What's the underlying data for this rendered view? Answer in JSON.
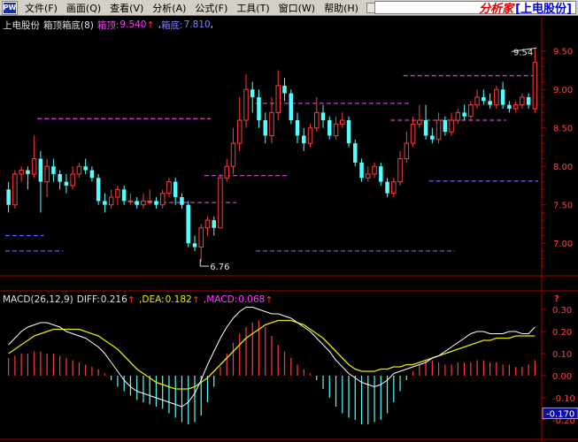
{
  "menu": {
    "logo": "PW",
    "items": [
      "文件(F)",
      "画面(Q)",
      "查看(V)",
      "分析(A)",
      "公式(F)",
      "工具(T)",
      "窗口(W)",
      "帮助(H)"
    ],
    "brand_name": "分析家",
    "brand_sub": "[上电股份]"
  },
  "price_panel": {
    "stock_name": "上电股份",
    "indicator": "箱顶箱底(8)",
    "box_top_label": "箱顶:",
    "box_top_value": "9.540",
    "box_bottom_label": "箱底:",
    "box_bottom_value": "7.810",
    "trailing": ",",
    "y_ticks": [
      "9.50",
      "9.00",
      "8.50",
      "8.00",
      "7.50",
      "7.00"
    ],
    "high_annotation": "9.54",
    "low_annotation": "6.76"
  },
  "macd_panel": {
    "title": "MACD(26,12,9)",
    "diff_label": "DIFF:",
    "diff_value": "0.216",
    "dea_label": "DEA:",
    "dea_value": "0.182",
    "macd_label": "MACD:",
    "macd_value": "0.068",
    "y_ticks": [
      "0.30",
      "0.20",
      "0.10",
      "0.00",
      "-0.10",
      "-0.20"
    ],
    "highlight_value": "-0.170",
    "question_mark": "?"
  },
  "colors": {
    "up": "#ff3c3c",
    "down": "#54ffff",
    "box_line": "#d040d0",
    "box_line_low": "#6060ff",
    "axis": "#b00000",
    "diff_line": "#ffffff",
    "dea_line": "#e8e800",
    "macd_label": "#ff40ff"
  },
  "chart_data": {
    "type": "candlestick",
    "price_ylim": [
      6.6,
      9.75
    ],
    "candles": [
      [
        7.7,
        7.5,
        7.8,
        7.4
      ],
      [
        7.5,
        7.9,
        7.95,
        7.45
      ],
      [
        7.9,
        7.95,
        8.0,
        7.8
      ],
      [
        7.95,
        7.9,
        8.0,
        7.7
      ],
      [
        7.9,
        8.1,
        8.4,
        7.85
      ],
      [
        8.1,
        7.8,
        8.2,
        7.4
      ],
      [
        7.8,
        8.0,
        8.1,
        7.6
      ],
      [
        8.0,
        7.9,
        8.1,
        7.8
      ],
      [
        7.9,
        7.8,
        7.95,
        7.7
      ],
      [
        7.8,
        7.75,
        7.9,
        7.65
      ],
      [
        7.75,
        7.9,
        8.0,
        7.7
      ],
      [
        7.9,
        8.0,
        8.05,
        7.85
      ],
      [
        8.0,
        7.95,
        8.1,
        7.9
      ],
      [
        7.95,
        7.85,
        8.0,
        7.8
      ],
      [
        7.85,
        7.55,
        7.9,
        7.5
      ],
      [
        7.55,
        7.5,
        7.65,
        7.4
      ],
      [
        7.5,
        7.6,
        7.7,
        7.45
      ],
      [
        7.6,
        7.7,
        7.75,
        7.5
      ],
      [
        7.7,
        7.55,
        7.75,
        7.5
      ],
      [
        7.55,
        7.55,
        7.65,
        7.5
      ],
      [
        7.55,
        7.5,
        7.6,
        7.45
      ],
      [
        7.5,
        7.55,
        7.65,
        7.45
      ],
      [
        7.55,
        7.55,
        7.7,
        7.5
      ],
      [
        7.55,
        7.5,
        7.6,
        7.45
      ],
      [
        7.5,
        7.65,
        7.7,
        7.45
      ],
      [
        7.65,
        7.8,
        7.85,
        7.6
      ],
      [
        7.8,
        7.6,
        7.85,
        7.5
      ],
      [
        7.6,
        7.5,
        7.65,
        7.45
      ],
      [
        7.5,
        7.0,
        7.55,
        6.95
      ],
      [
        7.0,
        6.95,
        7.1,
        6.9
      ],
      [
        6.95,
        7.2,
        7.25,
        6.76
      ],
      [
        7.2,
        7.3,
        7.35,
        7.1
      ],
      [
        7.3,
        7.2,
        7.35,
        7.1
      ],
      [
        7.2,
        7.85,
        7.9,
        7.2
      ],
      [
        7.85,
        8.0,
        8.1,
        7.8
      ],
      [
        8.0,
        8.3,
        8.5,
        7.9
      ],
      [
        8.3,
        8.6,
        8.9,
        8.2
      ],
      [
        8.6,
        9.0,
        9.2,
        8.5
      ],
      [
        9.0,
        8.9,
        9.1,
        8.7
      ],
      [
        8.9,
        8.6,
        9.0,
        8.5
      ],
      [
        8.6,
        8.4,
        8.7,
        8.3
      ],
      [
        8.4,
        8.7,
        8.9,
        8.3
      ],
      [
        8.7,
        9.05,
        9.25,
        8.6
      ],
      [
        9.05,
        8.95,
        9.15,
        8.85
      ],
      [
        8.95,
        8.6,
        9.0,
        8.55
      ],
      [
        8.6,
        8.4,
        8.7,
        8.3
      ],
      [
        8.4,
        8.3,
        8.5,
        8.2
      ],
      [
        8.3,
        8.5,
        8.55,
        8.25
      ],
      [
        8.5,
        8.7,
        8.9,
        8.45
      ],
      [
        8.7,
        8.6,
        8.8,
        8.5
      ],
      [
        8.6,
        8.4,
        8.65,
        8.35
      ],
      [
        8.4,
        8.55,
        8.65,
        8.35
      ],
      [
        8.55,
        8.6,
        8.7,
        8.5
      ],
      [
        8.6,
        8.3,
        8.65,
        8.25
      ],
      [
        8.3,
        8.05,
        8.35,
        8.0
      ],
      [
        8.05,
        7.85,
        8.1,
        7.8
      ],
      [
        7.85,
        7.9,
        8.0,
        7.8
      ],
      [
        7.9,
        8.0,
        8.05,
        7.85
      ],
      [
        8.0,
        7.8,
        8.05,
        7.75
      ],
      [
        7.8,
        7.65,
        7.85,
        7.6
      ],
      [
        7.65,
        7.8,
        7.85,
        7.6
      ],
      [
        7.8,
        8.1,
        8.2,
        7.75
      ],
      [
        8.1,
        8.3,
        8.45,
        8.05
      ],
      [
        8.3,
        8.55,
        8.65,
        8.25
      ],
      [
        8.55,
        8.6,
        8.8,
        8.5
      ],
      [
        8.6,
        8.4,
        8.8,
        8.35
      ],
      [
        8.4,
        8.35,
        8.5,
        8.3
      ],
      [
        8.35,
        8.6,
        8.7,
        8.3
      ],
      [
        8.6,
        8.45,
        8.65,
        8.4
      ],
      [
        8.45,
        8.6,
        8.7,
        8.4
      ],
      [
        8.6,
        8.7,
        8.75,
        8.55
      ],
      [
        8.7,
        8.65,
        8.8,
        8.6
      ],
      [
        8.65,
        8.8,
        8.85,
        8.6
      ],
      [
        8.8,
        8.9,
        9.0,
        8.75
      ],
      [
        8.9,
        8.85,
        9.0,
        8.8
      ],
      [
        8.85,
        8.8,
        8.95,
        8.75
      ],
      [
        8.8,
        9.0,
        9.05,
        8.75
      ],
      [
        9.0,
        8.8,
        9.1,
        8.75
      ],
      [
        8.8,
        8.75,
        8.85,
        8.7
      ],
      [
        8.75,
        8.8,
        8.85,
        8.7
      ],
      [
        8.8,
        8.9,
        8.95,
        8.75
      ],
      [
        8.9,
        8.8,
        8.95,
        8.75
      ],
      [
        8.75,
        9.35,
        9.54,
        8.7
      ]
    ],
    "box_levels": [
      {
        "from": 5,
        "to": 31,
        "value": 8.62,
        "style": "top"
      },
      {
        "from": 0,
        "to": 5,
        "value": 7.1,
        "style": "low"
      },
      {
        "from": 0,
        "to": 8,
        "value": 6.9,
        "style": "low"
      },
      {
        "from": 31,
        "to": 43,
        "value": 7.88,
        "style": "top"
      },
      {
        "from": 39,
        "to": 62,
        "value": 8.82,
        "style": "top"
      },
      {
        "from": 39,
        "to": 69,
        "value": 6.9,
        "style": "low"
      },
      {
        "from": 20,
        "to": 35,
        "value": 7.53,
        "style": "top"
      },
      {
        "from": 62,
        "to": 82,
        "value": 9.18,
        "style": "top"
      },
      {
        "from": 66,
        "to": 82,
        "value": 7.81,
        "style": "low"
      },
      {
        "from": 60,
        "to": 77,
        "value": 8.6,
        "style": "top"
      }
    ],
    "macd_ylim": [
      -0.26,
      0.32
    ],
    "macd_hist": [
      0.08,
      0.09,
      0.1,
      0.1,
      0.11,
      0.11,
      0.1,
      0.1,
      0.09,
      0.08,
      0.07,
      0.06,
      0.05,
      0.04,
      0.03,
      0.01,
      -0.02,
      -0.05,
      -0.07,
      -0.09,
      -0.11,
      -0.12,
      -0.13,
      -0.14,
      -0.15,
      -0.17,
      -0.19,
      -0.21,
      -0.22,
      -0.21,
      -0.18,
      -0.12,
      -0.05,
      0.04,
      0.1,
      0.15,
      0.19,
      0.22,
      0.24,
      0.25,
      0.22,
      0.18,
      0.14,
      0.11,
      0.08,
      0.05,
      0.03,
      0.01,
      -0.02,
      -0.06,
      -0.1,
      -0.14,
      -0.17,
      -0.19,
      -0.2,
      -0.22,
      -0.22,
      -0.21,
      -0.2,
      -0.17,
      -0.12,
      -0.07,
      -0.02,
      0.02,
      0.05,
      0.07,
      0.07,
      0.06,
      0.05,
      0.05,
      0.06,
      0.06,
      0.06,
      0.07,
      0.07,
      0.06,
      0.06,
      0.05,
      0.05,
      0.04,
      0.04,
      0.05,
      0.07
    ],
    "diff": [
      0.14,
      0.17,
      0.2,
      0.22,
      0.23,
      0.24,
      0.24,
      0.23,
      0.22,
      0.2,
      0.19,
      0.18,
      0.17,
      0.15,
      0.13,
      0.1,
      0.06,
      0.02,
      -0.02,
      -0.05,
      -0.07,
      -0.08,
      -0.09,
      -0.1,
      -0.11,
      -0.12,
      -0.13,
      -0.14,
      -0.12,
      -0.08,
      -0.02,
      0.05,
      0.11,
      0.17,
      0.22,
      0.26,
      0.29,
      0.31,
      0.31,
      0.3,
      0.29,
      0.28,
      0.28,
      0.27,
      0.26,
      0.24,
      0.22,
      0.2,
      0.17,
      0.14,
      0.11,
      0.07,
      0.04,
      0.01,
      -0.01,
      -0.03,
      -0.04,
      -0.05,
      -0.04,
      -0.02,
      0.01,
      0.02,
      0.03,
      0.04,
      0.05,
      0.06,
      0.08,
      0.09,
      0.11,
      0.13,
      0.15,
      0.17,
      0.19,
      0.2,
      0.2,
      0.19,
      0.19,
      0.19,
      0.2,
      0.2,
      0.19,
      0.19,
      0.22
    ],
    "dea": [
      0.1,
      0.12,
      0.14,
      0.16,
      0.18,
      0.19,
      0.2,
      0.21,
      0.21,
      0.21,
      0.21,
      0.21,
      0.2,
      0.19,
      0.18,
      0.16,
      0.14,
      0.12,
      0.09,
      0.06,
      0.03,
      0.01,
      -0.01,
      -0.03,
      -0.04,
      -0.05,
      -0.06,
      -0.06,
      -0.06,
      -0.05,
      -0.03,
      -0.01,
      0.02,
      0.05,
      0.08,
      0.11,
      0.14,
      0.17,
      0.19,
      0.21,
      0.23,
      0.24,
      0.25,
      0.25,
      0.25,
      0.24,
      0.23,
      0.21,
      0.19,
      0.17,
      0.14,
      0.11,
      0.08,
      0.05,
      0.03,
      0.02,
      0.02,
      0.02,
      0.03,
      0.03,
      0.04,
      0.04,
      0.05,
      0.05,
      0.06,
      0.07,
      0.08,
      0.09,
      0.1,
      0.11,
      0.12,
      0.13,
      0.14,
      0.15,
      0.16,
      0.16,
      0.17,
      0.17,
      0.17,
      0.18,
      0.18,
      0.18,
      0.18
    ]
  }
}
